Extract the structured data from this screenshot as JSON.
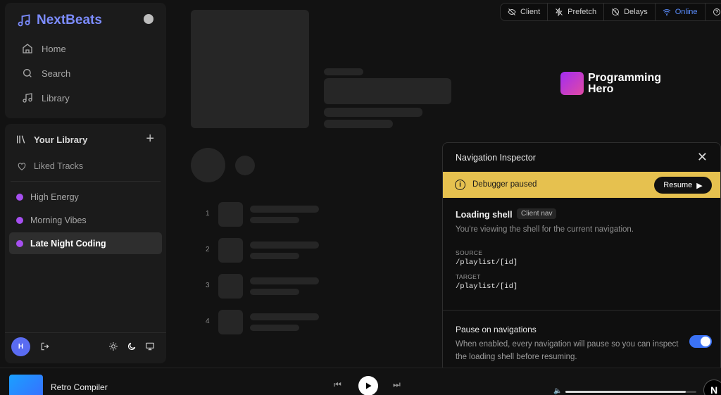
{
  "brand": {
    "name": "NextBeats"
  },
  "nav": {
    "items": [
      {
        "label": "Home"
      },
      {
        "label": "Search"
      },
      {
        "label": "Library"
      }
    ]
  },
  "library": {
    "title": "Your Library",
    "liked": "Liked Tracks",
    "playlists": [
      {
        "label": "High Energy"
      },
      {
        "label": "Morning Vibes"
      },
      {
        "label": "Late Night Coding",
        "active": true
      }
    ],
    "user_initial": "H"
  },
  "toolbar": {
    "items": [
      {
        "label": "Client"
      },
      {
        "label": "Prefetch"
      },
      {
        "label": "Delays"
      },
      {
        "label": "Online"
      }
    ]
  },
  "skeleton": {
    "track_numbers": [
      "1",
      "2",
      "3",
      "4"
    ]
  },
  "logo": {
    "line1": "Programming",
    "line2": "Hero"
  },
  "inspector": {
    "title": "Navigation Inspector",
    "banner": "Debugger paused",
    "resume": "Resume",
    "loading_title": "Loading shell",
    "badge": "Client nav",
    "description": "You're viewing the shell for the current navigation.",
    "source_label": "SOURCE",
    "source_value": "/playlist/[id]",
    "target_label": "TARGET",
    "target_value": "/playlist/[id]",
    "pause_title": "Pause on navigations",
    "pause_desc": "When enabled, every navigation will pause so you can inspect the loading shell before resuming.",
    "pause_enabled": true
  },
  "player": {
    "song": "Retro Compiler",
    "volume": 0.92,
    "badge": "N"
  },
  "colors": {
    "accent": "#7c8cff",
    "banner": "#e6c14f",
    "toggle": "#3b72f5",
    "online": "#5a8dff",
    "playlist_dot": "#a64ff0"
  }
}
